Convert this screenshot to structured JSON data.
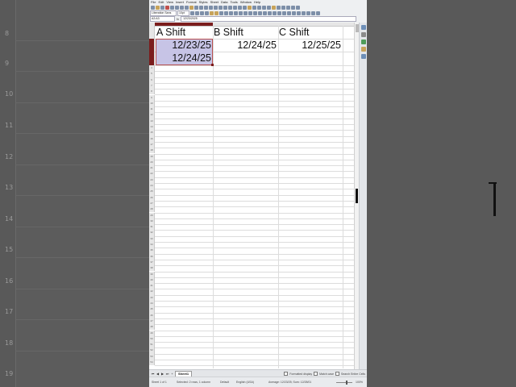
{
  "background": {
    "left_row_numbers": [
      "8",
      "9",
      "10",
      "11",
      "12",
      "13",
      "14",
      "15",
      "16",
      "17",
      "18",
      "19"
    ]
  },
  "menu": [
    "File",
    "Edit",
    "View",
    "Insert",
    "Format",
    "Styles",
    "Sheet",
    "Data",
    "Tools",
    "Window",
    "Help"
  ],
  "format_bar": {
    "font_name": "Liberation Sans",
    "font_size": "10pt"
  },
  "formula_bar": {
    "name_box": "A2:A3",
    "fx_label": "fx",
    "content": "12/23/2025"
  },
  "columns": [
    "A",
    "B",
    "C",
    "D"
  ],
  "rows": [
    "1",
    "2",
    "3",
    "4",
    "5",
    "6",
    "7",
    "8",
    "9",
    "10",
    "11",
    "12",
    "13",
    "14",
    "15",
    "16",
    "17",
    "18",
    "19",
    "20",
    "21",
    "22",
    "23",
    "24",
    "25",
    "26",
    "27",
    "28",
    "29",
    "30",
    "31",
    "32",
    "33",
    "34",
    "35",
    "36",
    "37",
    "38",
    "39",
    "40",
    "41",
    "42",
    "43",
    "44",
    "45",
    "46",
    "47",
    "48",
    "49",
    "50",
    "51",
    "52",
    "53",
    "54"
  ],
  "cells": {
    "a1": "A Shift",
    "b1": "B Shift",
    "c1": "C Shift",
    "a2": "12/23/25",
    "b2": "12/24/25",
    "c2": "12/25/25",
    "a3": "12/24/25"
  },
  "tabs": {
    "sheet1": "Sheet1",
    "format_display": "Formatted display",
    "search_case": "Match case",
    "search_entire": "Search Entire Cells"
  },
  "status": {
    "sheet": "Sheet 1 of 1",
    "selection": "Selected: 2 rows, 1 column",
    "style": "Default",
    "language": "English (USA)",
    "summary": "Average: 12/23/25; Sum: 12/28/01",
    "zoom": "100%"
  },
  "colors": {
    "selected_header": "#7b1d1d",
    "selected_cell": "#c7c4e6"
  }
}
